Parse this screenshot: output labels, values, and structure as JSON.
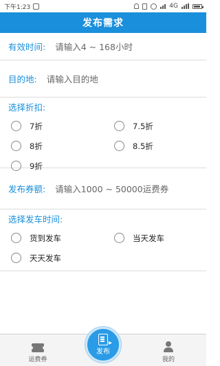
{
  "status_bar": {
    "time": "下午1:23",
    "network": "4G"
  },
  "header": {
    "title": "发布需求"
  },
  "form": {
    "validity": {
      "label": "有效时间:",
      "placeholder": "请输入4 ~ 168小时"
    },
    "destination": {
      "label": "目的地:",
      "placeholder": "请输入目的地"
    },
    "discount": {
      "label": "选择折扣:",
      "options": [
        "7折",
        "7.5折",
        "8折",
        "8.5折",
        "9折"
      ]
    },
    "amount": {
      "label": "发布券额:",
      "placeholder": "请输入1000 ~ 50000运费券"
    },
    "departure": {
      "label": "选择发车时间:",
      "options": [
        "货到发车",
        "当天发车",
        "天天发车"
      ]
    }
  },
  "bottom_nav": {
    "left": {
      "label": "运费券",
      "icon": "ticket-icon"
    },
    "center": {
      "label": "发布",
      "icon": "publish-doc-icon"
    },
    "right": {
      "label": "我的",
      "icon": "person-icon"
    }
  },
  "colors": {
    "accent": "#1a8fdb"
  }
}
